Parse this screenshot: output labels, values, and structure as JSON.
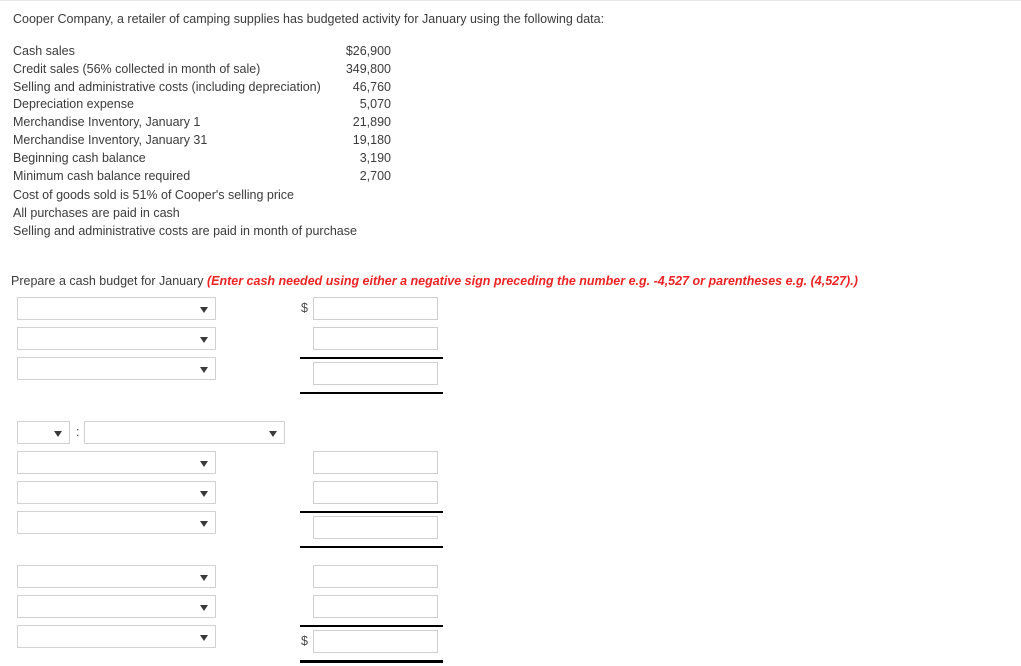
{
  "intro": "Cooper Company, a retailer of camping supplies has budgeted activity for January using the following data:",
  "facts": {
    "rows": [
      {
        "label": "Cash sales",
        "amount": "$26,900"
      },
      {
        "label": "Credit sales (56% collected in month of sale)",
        "amount": "349,800"
      },
      {
        "label": "Selling and administrative costs (including depreciation)",
        "amount": "46,760"
      },
      {
        "label": "Depreciation expense",
        "amount": "5,070"
      },
      {
        "label": "Merchandise Inventory, January 1",
        "amount": "21,890"
      },
      {
        "label": "Merchandise Inventory, January 31",
        "amount": "19,180"
      },
      {
        "label": "Beginning cash balance",
        "amount": "3,190"
      },
      {
        "label": "Minimum cash balance required",
        "amount": "2,700"
      }
    ]
  },
  "notes": [
    "Cost of goods sold is 51% of Cooper's selling price",
    "All purchases are paid in cash",
    "Selling and administrative costs are paid in month of purchase"
  ],
  "requirement": {
    "lead": "Prepare a cash budget for January ",
    "hint": "(Enter cash needed using either a negative sign preceding the number e.g. -4,527 or parentheses e.g. (4,527).)"
  },
  "form": {
    "select_placeholder": "",
    "input_placeholder": "",
    "currency_symbol": "$",
    "colon": ":",
    "groups": [
      {
        "name": "cash-receipts",
        "selects": [
          {
            "value": ""
          },
          {
            "value": ""
          },
          {
            "value": ""
          }
        ],
        "amounts": [
          {
            "value": "",
            "dollar": true
          },
          {
            "value": "",
            "dollar": false
          },
          {
            "value": "",
            "dollar": false
          }
        ]
      },
      {
        "name": "cash-payments",
        "header": {
          "prefix_select": "",
          "main_select": ""
        },
        "selects": [
          {
            "value": ""
          },
          {
            "value": ""
          },
          {
            "value": ""
          }
        ],
        "amounts": [
          {
            "value": "",
            "dollar": false
          },
          {
            "value": "",
            "dollar": false
          },
          {
            "value": "",
            "dollar": false
          }
        ]
      },
      {
        "name": "ending-cash",
        "selects": [
          {
            "value": ""
          },
          {
            "value": ""
          },
          {
            "value": ""
          }
        ],
        "amounts": [
          {
            "value": "",
            "dollar": false
          },
          {
            "value": "",
            "dollar": false
          },
          {
            "value": "",
            "dollar": true
          }
        ]
      }
    ]
  },
  "colors": {
    "text": "#3b3b3b",
    "hint_red": "#ee2222",
    "field_border": "#cfcfcf",
    "select_border": "#d2d2d2",
    "rule": "#000000"
  }
}
